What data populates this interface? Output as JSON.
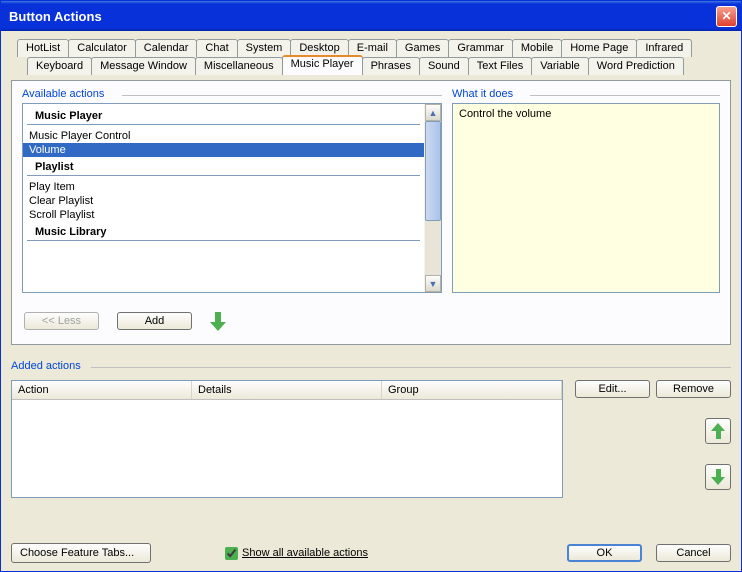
{
  "window": {
    "title": "Button Actions"
  },
  "tabs": {
    "row1": [
      "HotList",
      "Calculator",
      "Calendar",
      "Chat",
      "System",
      "Desktop",
      "E-mail",
      "Games",
      "Grammar",
      "Mobile",
      "Home Page",
      "Infrared"
    ],
    "row2": [
      "Keyboard",
      "Message Window",
      "Miscellaneous",
      "Music Player",
      "Phrases",
      "Sound",
      "Text Files",
      "Variable",
      "Word Prediction"
    ],
    "active": "Music Player"
  },
  "sections": {
    "available_label": "Available actions",
    "whatitdoes_label": "What it does",
    "added_label": "Added actions"
  },
  "available": {
    "groups": [
      {
        "header": "Music Player",
        "items": [
          "Music Player Control",
          "Volume"
        ]
      },
      {
        "header": "Playlist",
        "items": [
          "Play Item",
          "Clear Playlist",
          "Scroll Playlist"
        ]
      },
      {
        "header": "Music Library",
        "items": []
      }
    ],
    "selected": "Volume"
  },
  "description": "Control the volume",
  "buttons": {
    "less": "<< Less",
    "add": "Add",
    "edit": "Edit...",
    "remove": "Remove",
    "choose_tabs": "Choose Feature Tabs...",
    "ok": "OK",
    "cancel": "Cancel"
  },
  "table": {
    "columns": {
      "action": "Action",
      "details": "Details",
      "group": "Group"
    }
  },
  "checkbox": {
    "label": "Show all available actions",
    "checked": true
  }
}
